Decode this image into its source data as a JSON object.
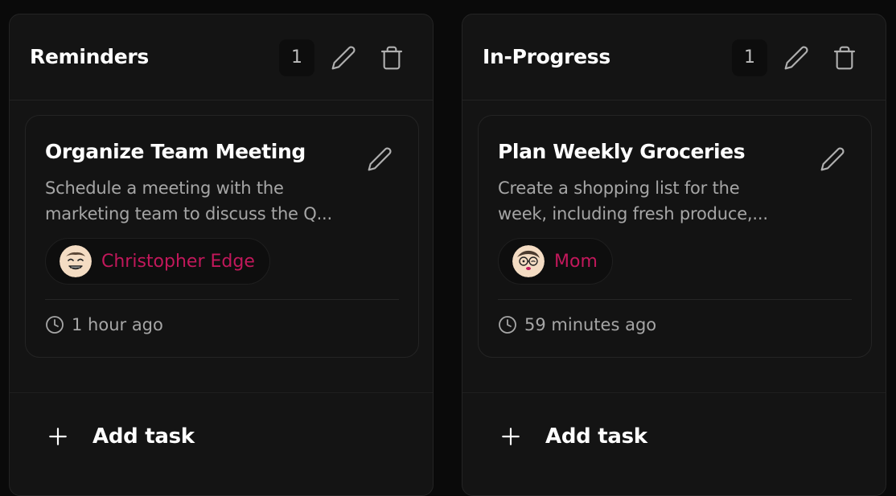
{
  "columns": [
    {
      "title": "Reminders",
      "count": "1",
      "card": {
        "title": "Organize Team Meeting",
        "description_lines": [
          "Schedule a meeting with the",
          "marketing team to discuss the Q..."
        ],
        "assignee": "Christopher Edge",
        "time": "1 hour ago"
      },
      "add_label": "Add task"
    },
    {
      "title": "In-Progress",
      "count": "1",
      "card": {
        "title": "Plan Weekly Groceries",
        "description_lines": [
          "Create a shopping list for the",
          "week, including fresh produce,..."
        ],
        "assignee": "Mom",
        "time": "59 minutes ago"
      },
      "add_label": "Add task"
    }
  ],
  "icons": {
    "count": "count-badge",
    "edit": "pencil-icon",
    "delete": "trash-icon",
    "time": "clock-icon",
    "add": "plus-icon"
  },
  "colors": {
    "background": "#0a0a0a",
    "column": "#141414",
    "card": "#131313",
    "assignee": "#c2185b",
    "muted_text": "#a6a6a6"
  }
}
